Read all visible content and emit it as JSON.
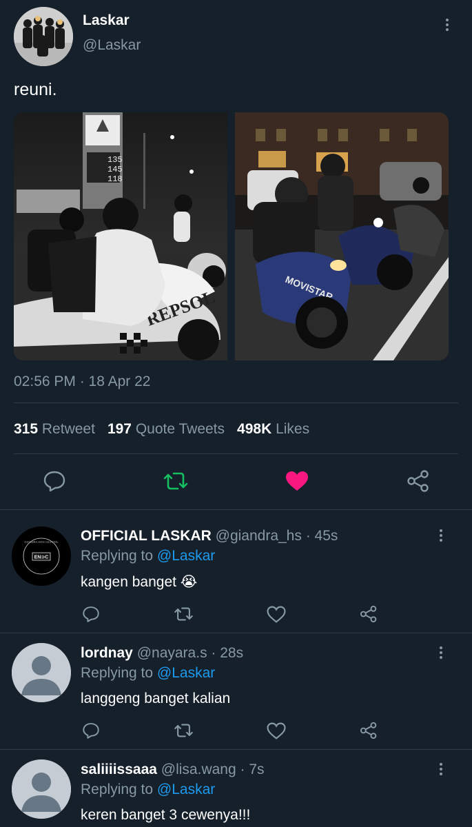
{
  "tweet": {
    "display_name": "Laskar",
    "handle": "@Laskar",
    "text": "reuni.",
    "timestamp": "02:56 PM · 18 Apr 22",
    "stats": {
      "retweets_count": "315",
      "retweets_label": "Retweet",
      "quotes_count": "197",
      "quotes_label": "Quote Tweets",
      "likes_count": "498K",
      "likes_label": "Likes"
    },
    "photo_overlays": {
      "gas_prices": [
        "135",
        "145",
        "118"
      ],
      "bike_left_text": "REPSOL",
      "bike_right_text": "MOVISTAR"
    }
  },
  "replies": [
    {
      "display_name": "OFFICIAL LASKAR",
      "handle": "@giandra_hs",
      "time": "· 45s",
      "replying_prefix": "Replying to",
      "replying_to": "@Laskar",
      "text": "kangen banget 😭",
      "avatar_logo_text": "EN⊃C",
      "avatar_ring_text": "GIANDRA HIGH SCHOOL"
    },
    {
      "display_name": "lordnay",
      "handle": "@nayara.s",
      "time": "· 28s",
      "replying_prefix": "Replying to",
      "replying_to": "@Laskar",
      "text": "langgeng banget kalian"
    },
    {
      "display_name": "saliiiissaaa",
      "handle": "@lisa.wang",
      "time": "· 7s",
      "replying_prefix": "Replying to",
      "replying_to": "@Laskar",
      "text": "keren banget 3 cewenya!!!"
    }
  ],
  "colors": {
    "background": "#15202b",
    "muted": "#8899a6",
    "link": "#1d9bf0",
    "retweet_active": "#17bf63",
    "like_active": "#f91880",
    "divider": "#2f3b47"
  }
}
